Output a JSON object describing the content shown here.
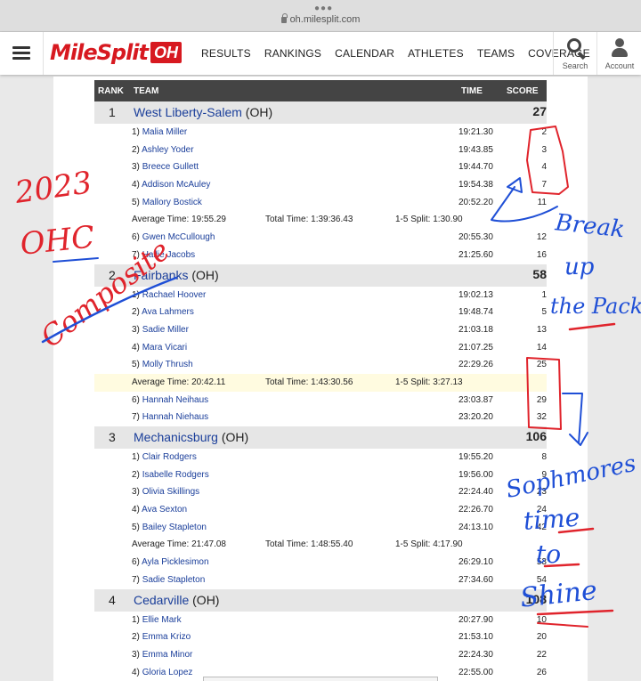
{
  "browser": {
    "url": "oh.milesplit.com"
  },
  "header": {
    "logo_text": "MileSplit",
    "logo_badge": "OH",
    "nav": [
      "RESULTS",
      "RANKINGS",
      "CALENDAR",
      "ATHLETES",
      "TEAMS",
      "COVERAGE"
    ],
    "search_label": "Search",
    "account_label": "Account",
    "icons": {
      "menu": "hamburger-icon",
      "search": "search-icon",
      "account": "user-icon"
    }
  },
  "table": {
    "headers": {
      "rank": "RANK",
      "team": "TEAM",
      "time": "TIME",
      "score": "SCORE"
    },
    "teams": [
      {
        "rank": "1",
        "name": "West Liberty-Salem",
        "state": "(OH)",
        "score": "27",
        "runners": [
          {
            "pos": "1)",
            "name": "Malia Miller",
            "time": "19:21.30",
            "pts": "2"
          },
          {
            "pos": "2)",
            "name": "Ashley Yoder",
            "time": "19:43.85",
            "pts": "3"
          },
          {
            "pos": "3)",
            "name": "Breece Gullett",
            "time": "19:44.70",
            "pts": "4"
          },
          {
            "pos": "4)",
            "name": "Addison McAuley",
            "time": "19:54.38",
            "pts": "7"
          },
          {
            "pos": "5)",
            "name": "Mallory Bostick",
            "time": "20:52.20",
            "pts": "11"
          }
        ],
        "avg": "Average Time: 19:55.29",
        "total": "Total Time: 1:39:36.43",
        "split": "1-5 Split: 1:30.90",
        "displacers": [
          {
            "pos": "6)",
            "name": "Gwen McCullough",
            "time": "20:55.30",
            "pts": "12"
          },
          {
            "pos": "7)",
            "name": "Hallie Jacobs",
            "time": "21:25.60",
            "pts": "16"
          }
        ]
      },
      {
        "rank": "2",
        "name": "Fairbanks",
        "state": "(OH)",
        "score": "58",
        "runners": [
          {
            "pos": "1)",
            "name": "Rachael Hoover",
            "time": "19:02.13",
            "pts": "1"
          },
          {
            "pos": "2)",
            "name": "Ava Lahmers",
            "time": "19:48.74",
            "pts": "5"
          },
          {
            "pos": "3)",
            "name": "Sadie Miller",
            "time": "21:03.18",
            "pts": "13"
          },
          {
            "pos": "4)",
            "name": "Mara Vicari",
            "time": "21:07.25",
            "pts": "14"
          },
          {
            "pos": "5)",
            "name": "Molly Thrush",
            "time": "22:29.26",
            "pts": "25"
          }
        ],
        "avg": "Average Time: 20:42.11",
        "total": "Total Time: 1:43:30.56",
        "split": "1-5 Split: 3:27.13",
        "displacers": [
          {
            "pos": "6)",
            "name": "Hannah Neihaus",
            "time": "23:03.87",
            "pts": "29"
          },
          {
            "pos": "7)",
            "name": "Hannah Niehaus",
            "time": "23:20.20",
            "pts": "32"
          }
        ]
      },
      {
        "rank": "3",
        "name": "Mechanicsburg",
        "state": "(OH)",
        "score": "106",
        "runners": [
          {
            "pos": "1)",
            "name": "Clair Rodgers",
            "time": "19:55.20",
            "pts": "8"
          },
          {
            "pos": "2)",
            "name": "Isabelle Rodgers",
            "time": "19:56.00",
            "pts": "9"
          },
          {
            "pos": "3)",
            "name": "Olivia Skillings",
            "time": "22:24.40",
            "pts": "23"
          },
          {
            "pos": "4)",
            "name": "Ava Sexton",
            "time": "22:26.70",
            "pts": "24"
          },
          {
            "pos": "5)",
            "name": "Bailey Stapleton",
            "time": "24:13.10",
            "pts": "42"
          }
        ],
        "avg": "Average Time: 21:47.08",
        "total": "Total Time: 1:48:55.40",
        "split": "1-5 Split: 4:17.90",
        "displacers": [
          {
            "pos": "6)",
            "name": "Ayla Picklesimon",
            "time": "26:29.10",
            "pts": "53"
          },
          {
            "pos": "7)",
            "name": "Sadie Stapleton",
            "time": "27:34.60",
            "pts": "54"
          }
        ]
      },
      {
        "rank": "4",
        "name": "Cedarville",
        "state": "(OH)",
        "score": "108",
        "runners": [
          {
            "pos": "1)",
            "name": "Ellie Mark",
            "time": "20:27.90",
            "pts": "10"
          },
          {
            "pos": "2)",
            "name": "Emma Krizo",
            "time": "21:53.10",
            "pts": "20"
          },
          {
            "pos": "3)",
            "name": "Emma Minor",
            "time": "22:24.30",
            "pts": "22"
          },
          {
            "pos": "4)",
            "name": "Gloria Lopez",
            "time": "22:55.00",
            "pts": "26"
          }
        ],
        "avg": "",
        "total": "",
        "split": "",
        "displacers": []
      }
    ]
  },
  "handwriting": {
    "colors": {
      "red": "#e0242c",
      "blue": "#1f4fd6"
    },
    "left_note": [
      "2023",
      "OHC",
      "Composite"
    ],
    "right_note_1": [
      "Break",
      "up",
      "the Pack"
    ],
    "right_note_2": [
      "Sophmores",
      "time",
      "to",
      "Shine"
    ]
  }
}
